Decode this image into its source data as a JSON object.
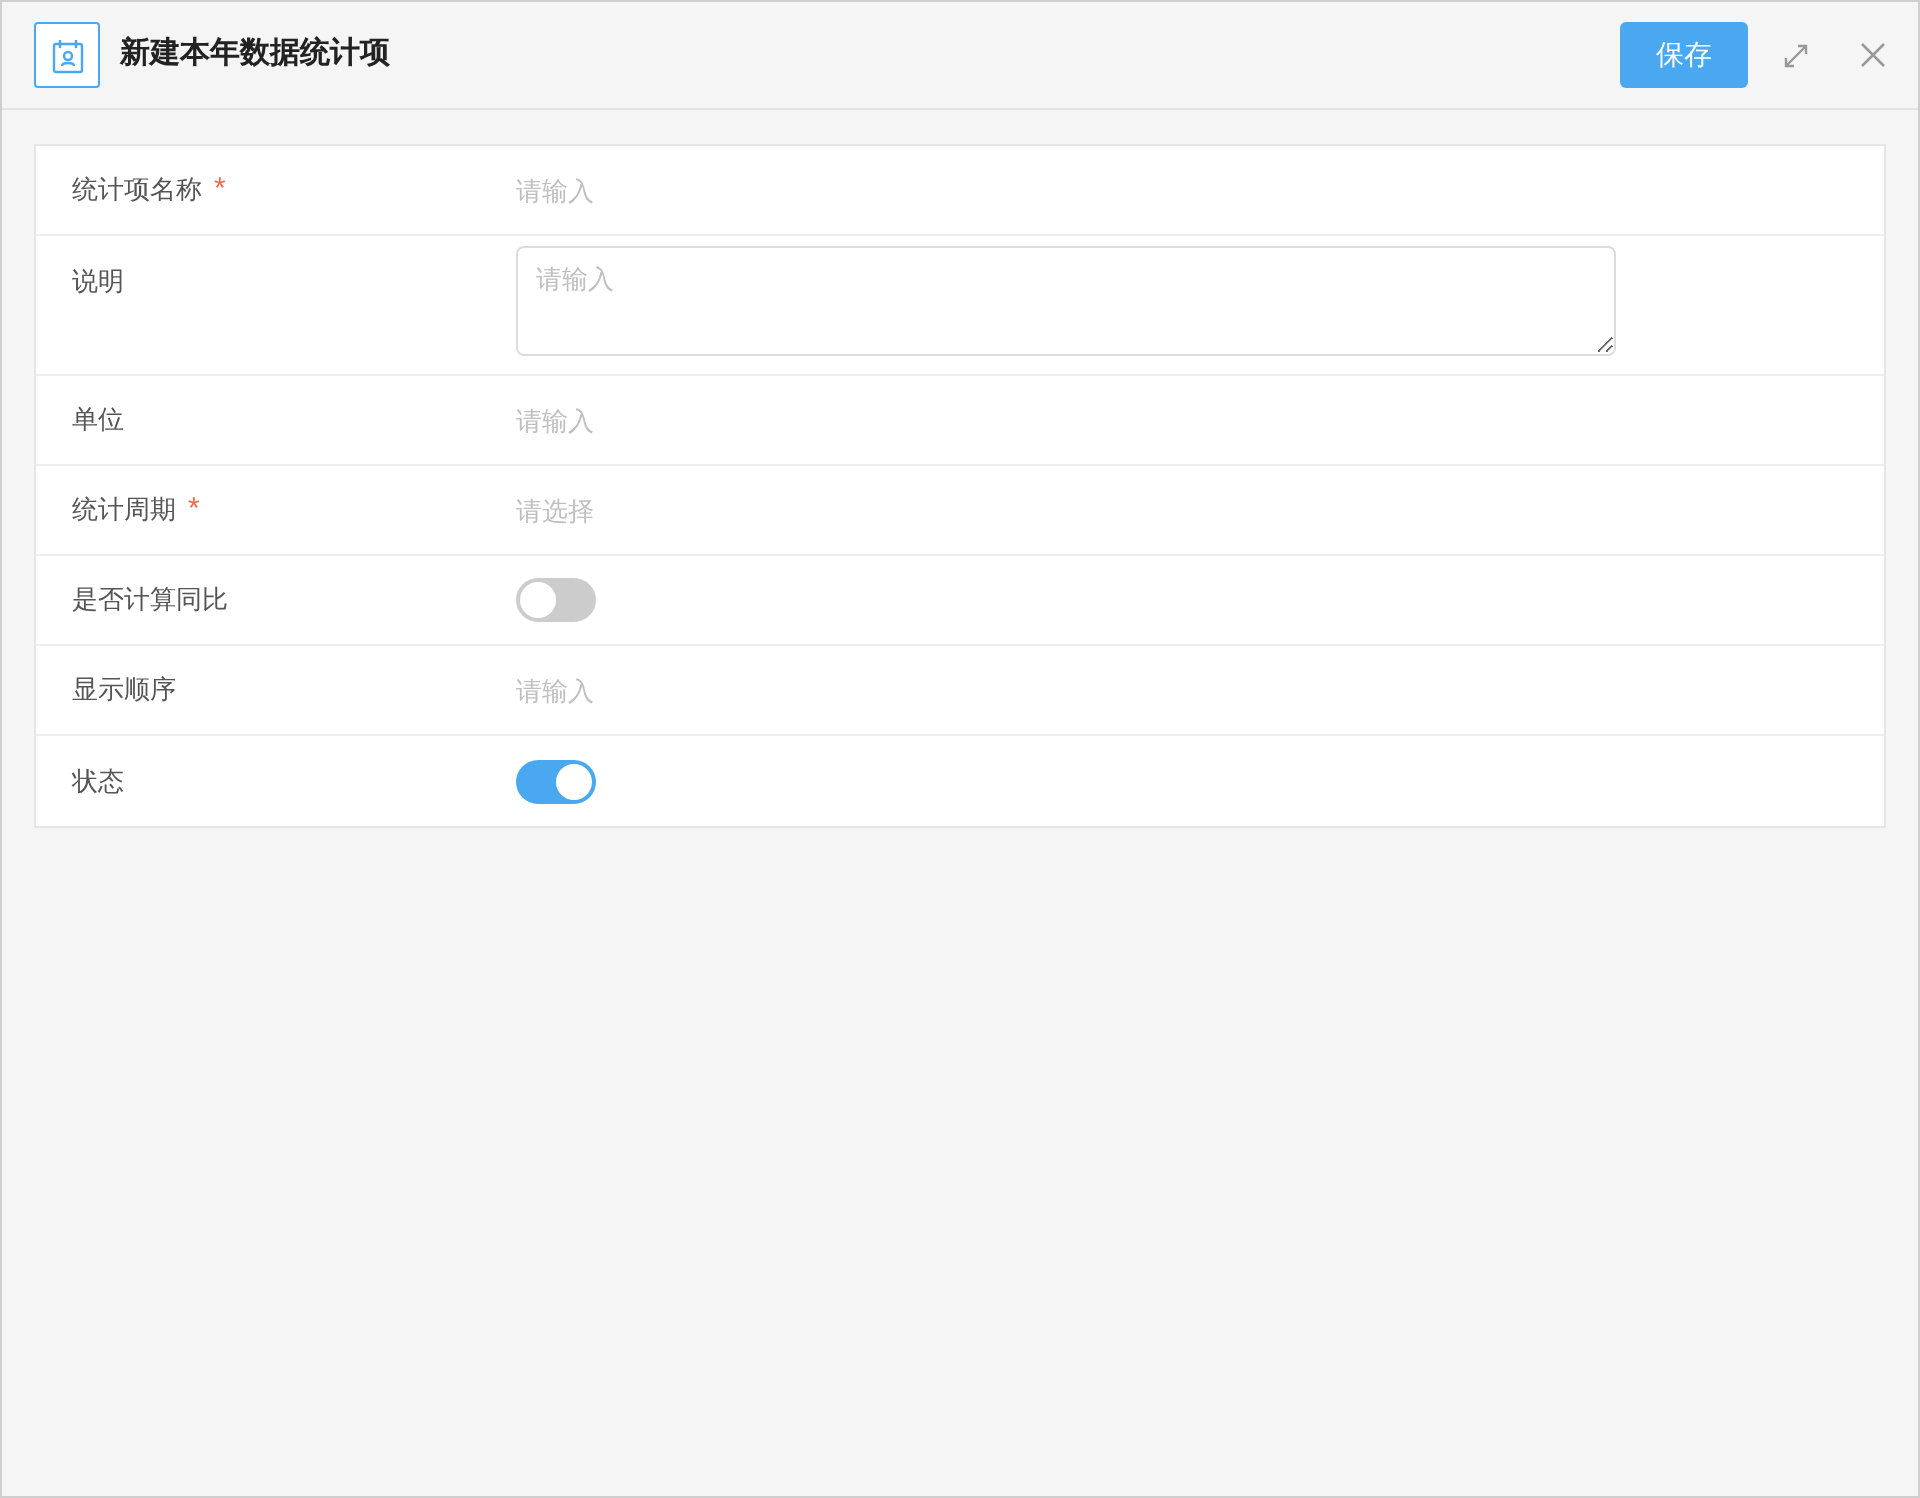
{
  "dialog": {
    "title": "新建本年数据统计项",
    "save_button": "保存"
  },
  "fields": [
    {
      "label": "统计项名称",
      "required_mark": "*",
      "kind": "input",
      "placeholder": "请输入"
    },
    {
      "label": "说明",
      "kind": "textarea",
      "placeholder": "请输入"
    },
    {
      "label": "单位",
      "kind": "input",
      "placeholder": "请输入"
    },
    {
      "label": "统计周期",
      "required_mark": "*",
      "kind": "select",
      "placeholder": "请选择"
    },
    {
      "label": "是否计算同比",
      "kind": "switch",
      "on": false
    },
    {
      "label": "显示顺序",
      "kind": "input",
      "placeholder": "请输入"
    },
    {
      "label": "状态",
      "kind": "switch",
      "on": true
    }
  ]
}
